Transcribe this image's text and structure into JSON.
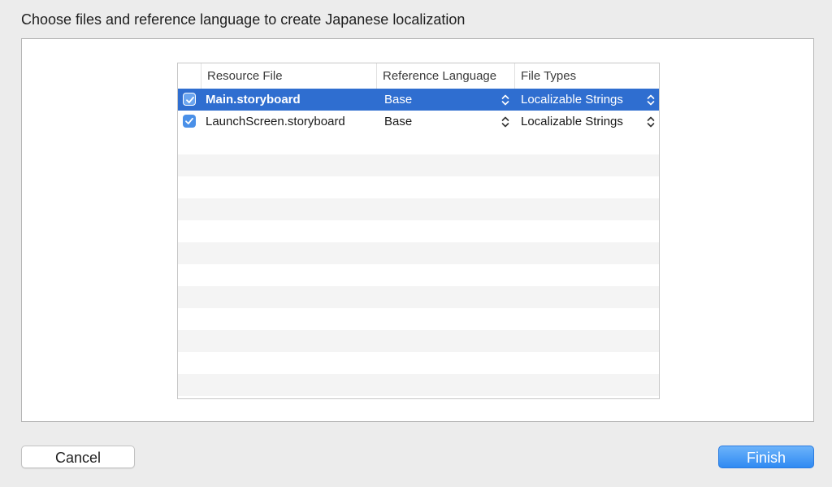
{
  "dialog": {
    "title": "Choose files and reference language to create Japanese localization"
  },
  "table": {
    "columns": {
      "resource_file": "Resource File",
      "reference_language": "Reference Language",
      "file_types": "File Types"
    },
    "rows": [
      {
        "checked": true,
        "name": "Main.storyboard",
        "language": "Base",
        "file_type": "Localizable Strings",
        "selected": true
      },
      {
        "checked": true,
        "name": "LaunchScreen.storyboard",
        "language": "Base",
        "file_type": "Localizable Strings",
        "selected": false
      }
    ]
  },
  "buttons": {
    "cancel": "Cancel",
    "finish": "Finish"
  },
  "colors": {
    "selection": "#2f6ed0",
    "accent": "#4a90e8",
    "finish": "#2f8af2"
  },
  "icons": {
    "checkbox": "checkmark-icon",
    "popup": "up-down-chevron-icon"
  }
}
